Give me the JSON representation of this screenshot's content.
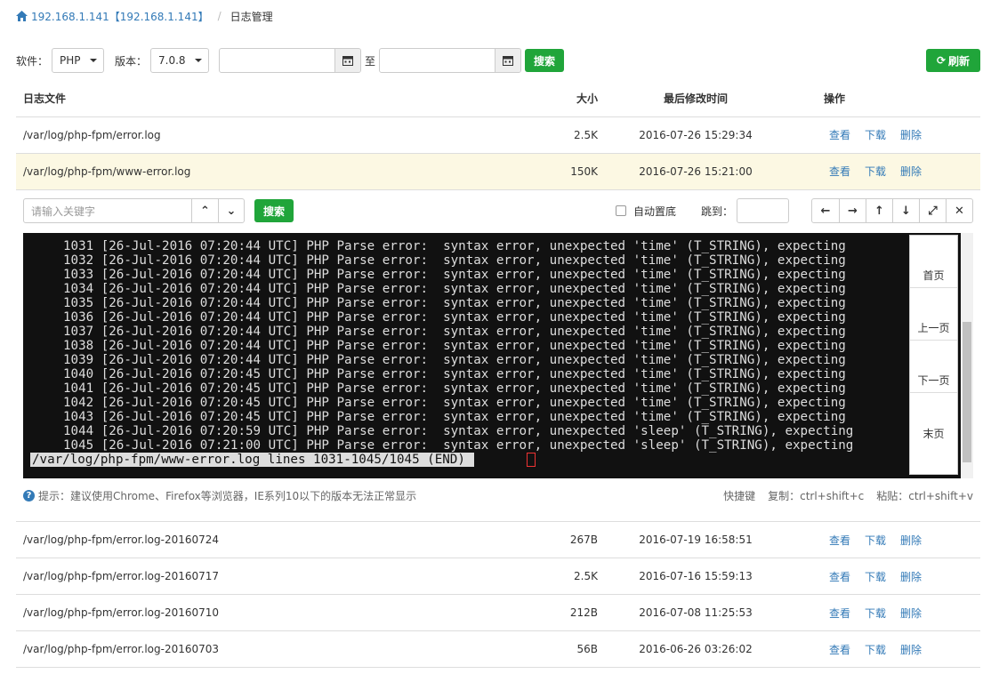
{
  "breadcrumb": {
    "home": "192.168.1.141【192.168.1.141】",
    "current": "日志管理"
  },
  "toolbar": {
    "software_label": "软件：",
    "software_value": "PHP",
    "version_label": "版本：",
    "version_value": "7.0.8",
    "to_label": "至",
    "search": "搜索",
    "refresh": "刷新"
  },
  "table": {
    "headers": {
      "file": "日志文件",
      "size": "大小",
      "time": "最后修改时间",
      "ops": "操作"
    },
    "actions": {
      "view": "查看",
      "download": "下载",
      "delete": "删除"
    },
    "rows": [
      {
        "file": "/var/log/php-fpm/error.log",
        "size": "2.5K",
        "time": "2016-07-26 15:29:34"
      },
      {
        "file": "/var/log/php-fpm/www-error.log",
        "size": "150K",
        "time": "2016-07-26 15:21:00"
      },
      {
        "file": "/var/log/php-fpm/error.log-20160724",
        "size": "267B",
        "time": "2016-07-19 16:58:51"
      },
      {
        "file": "/var/log/php-fpm/error.log-20160717",
        "size": "2.5K",
        "time": "2016-07-16 15:59:13"
      },
      {
        "file": "/var/log/php-fpm/error.log-20160710",
        "size": "212B",
        "time": "2016-07-08 11:25:53"
      },
      {
        "file": "/var/log/php-fpm/error.log-20160703",
        "size": "56B",
        "time": "2016-06-26 03:26:02"
      }
    ]
  },
  "viewer": {
    "keyword_placeholder": "请输入关键字",
    "search": "搜索",
    "autoscroll": "自动置底",
    "jump_label": "跳到：",
    "terminal_lines": [
      "1031 [26-Jul-2016 07:20:44 UTC] PHP Parse error:  syntax error, unexpected 'time' (T_STRING), expecting",
      "1032 [26-Jul-2016 07:20:44 UTC] PHP Parse error:  syntax error, unexpected 'time' (T_STRING), expecting",
      "1033 [26-Jul-2016 07:20:44 UTC] PHP Parse error:  syntax error, unexpected 'time' (T_STRING), expecting",
      "1034 [26-Jul-2016 07:20:44 UTC] PHP Parse error:  syntax error, unexpected 'time' (T_STRING), expecting",
      "1035 [26-Jul-2016 07:20:44 UTC] PHP Parse error:  syntax error, unexpected 'time' (T_STRING), expecting",
      "1036 [26-Jul-2016 07:20:44 UTC] PHP Parse error:  syntax error, unexpected 'time' (T_STRING), expecting",
      "1037 [26-Jul-2016 07:20:44 UTC] PHP Parse error:  syntax error, unexpected 'time' (T_STRING), expecting",
      "1038 [26-Jul-2016 07:20:44 UTC] PHP Parse error:  syntax error, unexpected 'time' (T_STRING), expecting",
      "1039 [26-Jul-2016 07:20:44 UTC] PHP Parse error:  syntax error, unexpected 'time' (T_STRING), expecting",
      "1040 [26-Jul-2016 07:20:45 UTC] PHP Parse error:  syntax error, unexpected 'time' (T_STRING), expecting",
      "1041 [26-Jul-2016 07:20:45 UTC] PHP Parse error:  syntax error, unexpected 'time' (T_STRING), expecting",
      "1042 [26-Jul-2016 07:20:45 UTC] PHP Parse error:  syntax error, unexpected 'time' (T_STRING), expecting",
      "1043 [26-Jul-2016 07:20:45 UTC] PHP Parse error:  syntax error, unexpected 'time' (T_STRING), expecting",
      "1044 [26-Jul-2016 07:20:59 UTC] PHP Parse error:  syntax error, unexpected 'sleep' (T_STRING), expecting",
      "1045 [26-Jul-2016 07:21:00 UTC] PHP Parse error:  syntax error, unexpected 'sleep' (T_STRING), expecting"
    ],
    "status_line": "/var/log/php-fpm/www-error.log lines 1031-1045/1045 (END) ",
    "pager": [
      "首页",
      "上一页",
      "下一页",
      "末页"
    ]
  },
  "hint": {
    "text": "提示：建议使用Chrome、Firefox等浏览器，IE系列10以下的版本无法正常显示",
    "shortcut": "快捷键",
    "copy": "复制：ctrl+shift+c",
    "paste": "粘贴：ctrl+shift+v"
  },
  "colors": {
    "accent_green": "#20a53a",
    "link_blue": "#337ab7",
    "highlight_row": "#fcf8e3"
  }
}
